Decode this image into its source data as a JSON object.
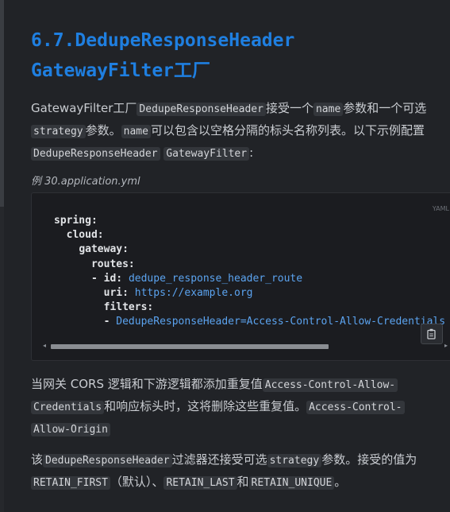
{
  "heading": {
    "line1": "6.7.DedupeResponseHeader",
    "line2": "GatewayFilter工厂"
  },
  "para1": {
    "t1": "GatewayFilter工厂",
    "c1": "DedupeResponseHeader",
    "t2": "接受一个",
    "c2": "name",
    "t3": "参数和一个可选",
    "c3": "strategy",
    "t4": "参数。",
    "c4": "name",
    "t5": "可以包含以空格分隔的标头名称列表。以下示例配置",
    "c5": "DedupeResponseHeader",
    "c6": "GatewayFilter",
    "t6": ":"
  },
  "example": {
    "caption": "例 30.application.yml",
    "lang": "YAML",
    "lines": {
      "l1": "spring:",
      "l2": "cloud:",
      "l3": "gateway:",
      "l4": "routes:",
      "l5k": "- id: ",
      "l5v": "dedupe_response_header_route",
      "l6k": "uri: ",
      "l6v": "https://example.org",
      "l7": "filters:",
      "l8k": "- ",
      "l8v": "DedupeResponseHeader=Access-Control-Allow-Credentials Access-Control-Allow-Origin"
    }
  },
  "para2": {
    "t1": "当网关 CORS 逻辑和下游逻辑都添加重复值",
    "c1": "Access-Control-Allow-",
    "c1b": "Credentials",
    "t2": "和响应标头时，这将删除这些重复值。",
    "c2": "Access-Control-",
    "c2b": "Allow-Origin"
  },
  "para3": {
    "t1": "该",
    "c1": "DedupeResponseHeader",
    "t2": "过滤器还接受可选",
    "c2": "strategy",
    "t3": "参数。接受的值为",
    "c3": "RETAIN_FIRST",
    "t4": "（默认）、",
    "c4": "RETAIN_LAST",
    "t5": "和",
    "c5": "RETAIN_UNIQUE",
    "t6": "。"
  },
  "icons": {
    "copy": "copy-icon",
    "left": "scroll-left-icon",
    "right": "scroll-right-icon"
  }
}
